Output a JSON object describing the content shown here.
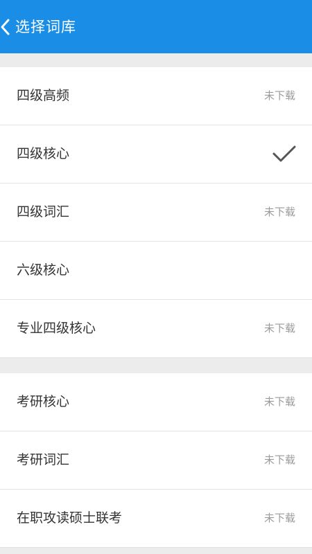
{
  "header": {
    "title": "选择词库"
  },
  "colors": {
    "header_bg": "#1a8ee6",
    "page_bg": "#ececed",
    "text_primary": "#333333",
    "text_secondary": "#9a9a9a",
    "check": "#555555"
  },
  "groups": [
    {
      "items": [
        {
          "label": "四级高频",
          "status": "未下载",
          "selected": false
        },
        {
          "label": "四级核心",
          "status": "",
          "selected": true
        },
        {
          "label": "四级词汇",
          "status": "未下载",
          "selected": false
        },
        {
          "label": "六级核心",
          "status": "",
          "selected": false
        },
        {
          "label": "专业四级核心",
          "status": "未下载",
          "selected": false
        }
      ]
    },
    {
      "items": [
        {
          "label": "考研核心",
          "status": "未下载",
          "selected": false
        },
        {
          "label": "考研词汇",
          "status": "未下载",
          "selected": false
        },
        {
          "label": "在职攻读硕士联考",
          "status": "未下载",
          "selected": false
        }
      ]
    }
  ],
  "icons": {
    "back": "chevron-left-icon",
    "selected": "check-icon"
  }
}
